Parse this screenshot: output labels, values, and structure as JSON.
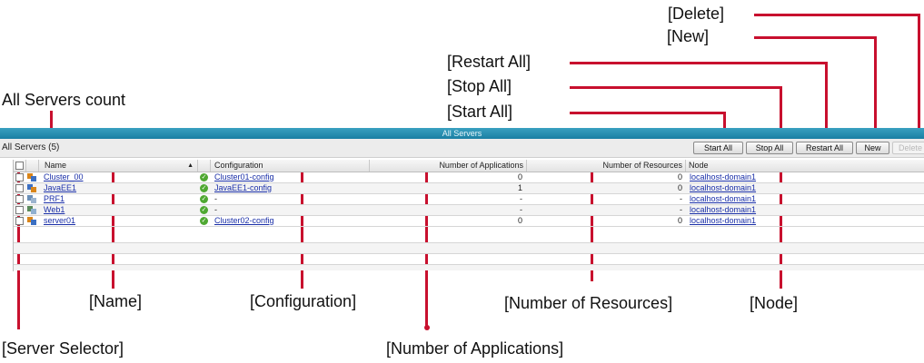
{
  "callouts": {
    "delete": "[Delete]",
    "new": "[New]",
    "restart_all": "[Restart All]",
    "stop_all": "[Stop All]",
    "start_all": "[Start All]",
    "all_servers_count": "All Servers count",
    "name": "[Name]",
    "configuration": "[Configuration]",
    "number_of_resources": "[Number of Resources]",
    "node": "[Node]",
    "server_selector": "[Server Selector]",
    "number_of_applications": "[Number of Applications]"
  },
  "panel": {
    "title": "All Servers",
    "count_label": "All Servers (5)"
  },
  "toolbar": {
    "start_all": "Start All",
    "stop_all": "Stop All",
    "restart_all": "Restart All",
    "new": "New",
    "delete": "Delete"
  },
  "table": {
    "headers": {
      "name": "Name",
      "sort_indicator": "▲",
      "configuration": "Configuration",
      "apps": "Number of Applications",
      "resources": "Number of Resources",
      "node": "Node"
    },
    "rows": [
      {
        "name": "Cluster_00",
        "config": "Cluster01-config",
        "apps": "0",
        "resources": "0",
        "node": "localhost-domain1",
        "icon": "cluster-icon"
      },
      {
        "name": "JavaEE1",
        "config": "JavaEE1-config",
        "apps": "1",
        "resources": "0",
        "node": "localhost-domain1",
        "icon": "server-icon"
      },
      {
        "name": "PRF1",
        "config": "-",
        "apps": "-",
        "resources": "-",
        "node": "localhost-domain1",
        "icon": "proxy-icon"
      },
      {
        "name": "Web1",
        "config": "-",
        "apps": "-",
        "resources": "-",
        "node": "localhost-domain1",
        "icon": "web-server-icon"
      },
      {
        "name": "server01",
        "config": "Cluster02-config",
        "apps": "0",
        "resources": "0",
        "node": "localhost-domain1",
        "icon": "cluster-icon"
      }
    ]
  },
  "colors": {
    "callout_line": "#c8102e",
    "title_bar": "#1a7fa3",
    "link": "#1a2fa8",
    "status_ok": "#4fa832"
  }
}
